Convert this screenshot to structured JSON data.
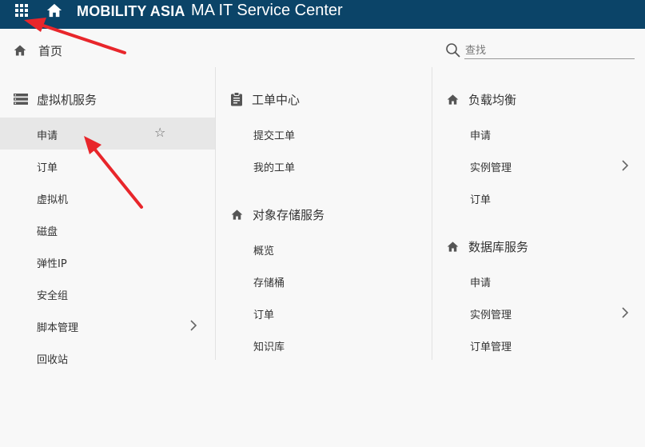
{
  "header": {
    "brand": "MOBILITY ASIA",
    "title": "MA IT Service Center",
    "icons": [
      "apps-grid-icon",
      "home-icon"
    ],
    "background_color": "#0b4468"
  },
  "home": {
    "label": "首页",
    "icon": "home-icon"
  },
  "search": {
    "placeholder": "查找",
    "value": "",
    "icon": "search-icon"
  },
  "columns": [
    {
      "sections": [
        {
          "title": "虚拟机服务",
          "icon": "server-icon",
          "items": [
            {
              "label": "申请",
              "active": true,
              "star": "☆"
            },
            {
              "label": "订单"
            },
            {
              "label": "虚拟机"
            },
            {
              "label": "磁盘"
            },
            {
              "label": "弹性IP"
            },
            {
              "label": "安全组"
            },
            {
              "label": "脚本管理",
              "submenu": true
            },
            {
              "label": "回收站"
            }
          ]
        }
      ]
    },
    {
      "sections": [
        {
          "title": "工单中心",
          "icon": "clipboard-icon",
          "items": [
            {
              "label": "提交工单"
            },
            {
              "label": "我的工单"
            }
          ]
        },
        {
          "title": "对象存储服务",
          "icon": "home-icon",
          "items": [
            {
              "label": "概览"
            },
            {
              "label": "存储桶"
            },
            {
              "label": "订单"
            },
            {
              "label": "知识库"
            }
          ]
        }
      ]
    },
    {
      "sections": [
        {
          "title": "负载均衡",
          "icon": "home-icon",
          "items": [
            {
              "label": "申请"
            },
            {
              "label": "实例管理",
              "submenu": true
            },
            {
              "label": "订单"
            }
          ]
        },
        {
          "title": "数据库服务",
          "icon": "home-icon",
          "items": [
            {
              "label": "申请"
            },
            {
              "label": "实例管理",
              "submenu": true
            },
            {
              "label": "订单管理"
            }
          ]
        }
      ]
    }
  ],
  "colors": {
    "active_row": "#e7e7e7",
    "annotation_arrow": "#e8262b"
  }
}
